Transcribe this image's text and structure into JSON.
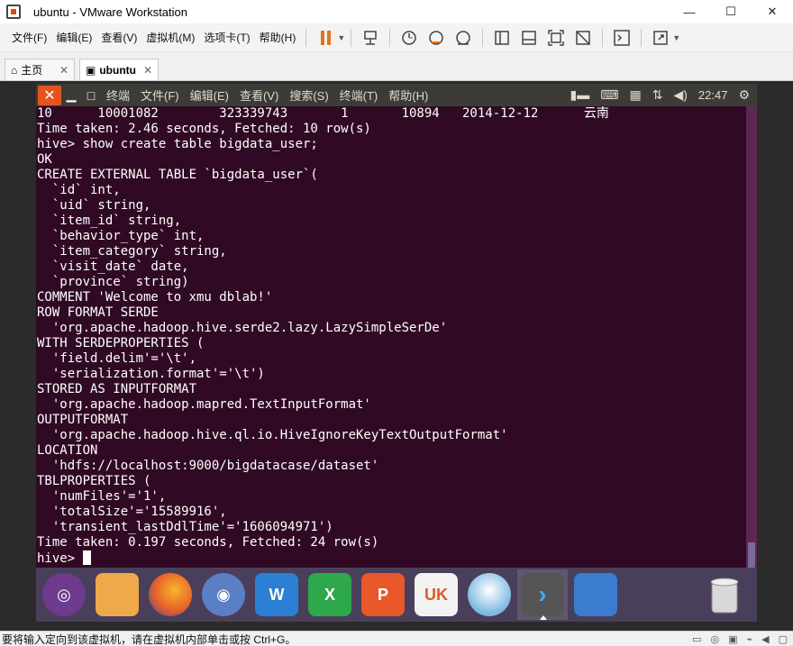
{
  "window": {
    "title": "ubuntu - VMware Workstation",
    "minimize": "—",
    "maximize": "☐",
    "close": "✕"
  },
  "menubar": {
    "items": [
      "文件(F)",
      "编辑(E)",
      "查看(V)",
      "虚拟机(M)",
      "选项卡(T)",
      "帮助(H)"
    ]
  },
  "tabs": {
    "home_label": "主页",
    "active_label": "ubuntu",
    "close": "✕"
  },
  "panel": {
    "close_glyph": "✕",
    "min_glyph": "▁",
    "max_glyph": "□",
    "menus": [
      "终端",
      "文件(F)",
      "编辑(E)",
      "查看(V)",
      "搜索(S)",
      "终端(T)",
      "帮助(H)"
    ],
    "clock": "22:47"
  },
  "terminal": {
    "lines": [
      "10      10001082        323339743       1       10894   2014-12-12      云南",
      "Time taken: 2.46 seconds, Fetched: 10 row(s)",
      "hive> show create table bigdata_user;",
      "OK",
      "CREATE EXTERNAL TABLE `bigdata_user`(",
      "  `id` int,",
      "  `uid` string,",
      "  `item_id` string,",
      "  `behavior_type` int,",
      "  `item_category` string,",
      "  `visit_date` date,",
      "  `province` string)",
      "COMMENT 'Welcome to xmu dblab!'",
      "ROW FORMAT SERDE",
      "  'org.apache.hadoop.hive.serde2.lazy.LazySimpleSerDe'",
      "WITH SERDEPROPERTIES (",
      "  'field.delim'='\\t',",
      "  'serialization.format'='\\t')",
      "STORED AS INPUTFORMAT",
      "  'org.apache.hadoop.mapred.TextInputFormat'",
      "OUTPUTFORMAT",
      "  'org.apache.hadoop.hive.ql.io.HiveIgnoreKeyTextOutputFormat'",
      "LOCATION",
      "  'hdfs://localhost:9000/bigdatacase/dataset'",
      "TBLPROPERTIES (",
      "  'numFiles'='1',",
      "  'totalSize'='15589916',",
      "  'transient_lastDdlTime'='1606094971')",
      "Time taken: 0.197 seconds, Fetched: 24 row(s)"
    ],
    "prompt": "hive> "
  },
  "dock": {
    "apps": [
      {
        "icon": "ubuntu-logo-icon",
        "color": "#6e3a8e",
        "glyph": "◎"
      },
      {
        "icon": "files-icon",
        "color": "#f0a94a",
        "glyph": ""
      },
      {
        "icon": "firefox-icon",
        "color": "#e8602b",
        "glyph": ""
      },
      {
        "icon": "chromium-icon",
        "color": "#5b7fc4",
        "glyph": "◉"
      },
      {
        "icon": "writer-icon",
        "color": "#2b7fd4",
        "glyph": "W"
      },
      {
        "icon": "calc-icon",
        "color": "#2ea84a",
        "glyph": "X"
      },
      {
        "icon": "impress-icon",
        "color": "#e8582b",
        "glyph": "P"
      },
      {
        "icon": "software-center-icon",
        "color": "#d95c2b",
        "glyph": "UK"
      },
      {
        "icon": "robot-icon",
        "color": "#7bb8e0",
        "glyph": ""
      },
      {
        "icon": "terminal-icon",
        "color": "#555555",
        "glyph": "›"
      },
      {
        "icon": "workspaces-icon",
        "color": "#3a7ccf",
        "glyph": ""
      }
    ],
    "trash_icon": "trash-icon"
  },
  "statusbar": {
    "message": "要将输入定向到该虚拟机，请在虚拟机内部单击或按 Ctrl+G。"
  },
  "colors": {
    "terminal_bg": "#300a24",
    "panel_bg": "#3c3b37",
    "accent": "#e5541f"
  }
}
